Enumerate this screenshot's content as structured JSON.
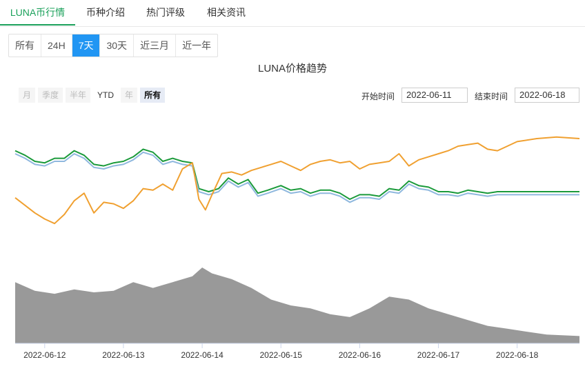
{
  "tabs": [
    "LUNA币行情",
    "币种介绍",
    "热门评级",
    "相关资讯"
  ],
  "ranges": [
    "所有",
    "24H",
    "7天",
    "30天",
    "近三月",
    "近一年"
  ],
  "range_selected": "7天",
  "zoom_buttons": [
    "月",
    "季度",
    "半年",
    "YTD",
    "年",
    "所有"
  ],
  "zoom_selected": "所有",
  "start_label": "开始时间",
  "start_date": "2022-06-11",
  "end_label": "结束时间",
  "end_date": "2022-06-18",
  "colors": {
    "accent": "#1aa05a",
    "range_active": "#2196f3",
    "green_line": "#1a9a3a",
    "blue_line": "#8fb8de",
    "orange_line": "#f0a030",
    "volume": "#999999"
  },
  "chart_data": {
    "type": "line",
    "title": "LUNA价格趋势",
    "x_ticks": [
      "2022-06-12",
      "2022-06-13",
      "2022-06-14",
      "2022-06-15",
      "2022-06-16",
      "2022-06-17",
      "2022-06-18"
    ],
    "x_range": [
      "2022-06-11T15:00",
      "2022-06-18T19:00"
    ],
    "y_ticks": [],
    "legend": "none",
    "grid": false,
    "series": [
      {
        "color": "green",
        "points": [
          [
            "06-11T15:00",
            0.87
          ],
          [
            "06-11T18:00",
            0.84
          ],
          [
            "06-11T21:00",
            0.8
          ],
          [
            "06-12T00:00",
            0.79
          ],
          [
            "06-12T03:00",
            0.82
          ],
          [
            "06-12T06:00",
            0.82
          ],
          [
            "06-12T09:00",
            0.87
          ],
          [
            "06-12T12:00",
            0.84
          ],
          [
            "06-12T15:00",
            0.78
          ],
          [
            "06-12T18:00",
            0.77
          ],
          [
            "06-12T21:00",
            0.79
          ],
          [
            "06-13T00:00",
            0.8
          ],
          [
            "06-13T03:00",
            0.83
          ],
          [
            "06-13T06:00",
            0.88
          ],
          [
            "06-13T09:00",
            0.86
          ],
          [
            "06-13T12:00",
            0.8
          ],
          [
            "06-13T15:00",
            0.82
          ],
          [
            "06-13T18:00",
            0.8
          ],
          [
            "06-13T21:00",
            0.79
          ],
          [
            "06-13T23:00",
            0.62
          ],
          [
            "06-14T02:00",
            0.6
          ],
          [
            "06-14T05:00",
            0.62
          ],
          [
            "06-14T08:00",
            0.69
          ],
          [
            "06-14T11:00",
            0.65
          ],
          [
            "06-14T14:00",
            0.68
          ],
          [
            "06-14T17:00",
            0.59
          ],
          [
            "06-14T20:00",
            0.61
          ],
          [
            "06-15T00:00",
            0.64
          ],
          [
            "06-15T03:00",
            0.61
          ],
          [
            "06-15T06:00",
            0.62
          ],
          [
            "06-15T09:00",
            0.59
          ],
          [
            "06-15T12:00",
            0.61
          ],
          [
            "06-15T15:00",
            0.61
          ],
          [
            "06-15T18:00",
            0.59
          ],
          [
            "06-15T21:00",
            0.55
          ],
          [
            "06-16T00:00",
            0.58
          ],
          [
            "06-16T03:00",
            0.58
          ],
          [
            "06-16T06:00",
            0.57
          ],
          [
            "06-16T09:00",
            0.62
          ],
          [
            "06-16T12:00",
            0.61
          ],
          [
            "06-16T15:00",
            0.67
          ],
          [
            "06-16T18:00",
            0.64
          ],
          [
            "06-16T21:00",
            0.63
          ],
          [
            "06-17T00:00",
            0.6
          ],
          [
            "06-17T03:00",
            0.6
          ],
          [
            "06-17T06:00",
            0.59
          ],
          [
            "06-17T09:00",
            0.61
          ],
          [
            "06-17T12:00",
            0.6
          ],
          [
            "06-17T15:00",
            0.59
          ],
          [
            "06-17T18:00",
            0.6
          ],
          [
            "06-18T00:00",
            0.6
          ],
          [
            "06-18T06:00",
            0.6
          ],
          [
            "06-18T12:00",
            0.6
          ],
          [
            "06-18T19:00",
            0.6
          ]
        ]
      },
      {
        "color": "blue",
        "points": [
          [
            "06-11T15:00",
            0.85
          ],
          [
            "06-11T18:00",
            0.82
          ],
          [
            "06-11T21:00",
            0.78
          ],
          [
            "06-12T00:00",
            0.77
          ],
          [
            "06-12T03:00",
            0.8
          ],
          [
            "06-12T06:00",
            0.8
          ],
          [
            "06-12T09:00",
            0.85
          ],
          [
            "06-12T12:00",
            0.82
          ],
          [
            "06-12T15:00",
            0.76
          ],
          [
            "06-12T18:00",
            0.75
          ],
          [
            "06-12T21:00",
            0.77
          ],
          [
            "06-13T00:00",
            0.78
          ],
          [
            "06-13T03:00",
            0.81
          ],
          [
            "06-13T06:00",
            0.86
          ],
          [
            "06-13T09:00",
            0.84
          ],
          [
            "06-13T12:00",
            0.78
          ],
          [
            "06-13T15:00",
            0.8
          ],
          [
            "06-13T18:00",
            0.78
          ],
          [
            "06-13T21:00",
            0.77
          ],
          [
            "06-13T23:00",
            0.6
          ],
          [
            "06-14T02:00",
            0.58
          ],
          [
            "06-14T05:00",
            0.6
          ],
          [
            "06-14T08:00",
            0.67
          ],
          [
            "06-14T11:00",
            0.63
          ],
          [
            "06-14T14:00",
            0.66
          ],
          [
            "06-14T17:00",
            0.57
          ],
          [
            "06-14T20:00",
            0.59
          ],
          [
            "06-15T00:00",
            0.62
          ],
          [
            "06-15T03:00",
            0.59
          ],
          [
            "06-15T06:00",
            0.6
          ],
          [
            "06-15T09:00",
            0.57
          ],
          [
            "06-15T12:00",
            0.59
          ],
          [
            "06-15T15:00",
            0.59
          ],
          [
            "06-15T18:00",
            0.57
          ],
          [
            "06-15T21:00",
            0.53
          ],
          [
            "06-16T00:00",
            0.56
          ],
          [
            "06-16T03:00",
            0.56
          ],
          [
            "06-16T06:00",
            0.55
          ],
          [
            "06-16T09:00",
            0.6
          ],
          [
            "06-16T12:00",
            0.59
          ],
          [
            "06-16T15:00",
            0.65
          ],
          [
            "06-16T18:00",
            0.62
          ],
          [
            "06-16T21:00",
            0.61
          ],
          [
            "06-17T00:00",
            0.58
          ],
          [
            "06-17T03:00",
            0.58
          ],
          [
            "06-17T06:00",
            0.57
          ],
          [
            "06-17T09:00",
            0.59
          ],
          [
            "06-17T12:00",
            0.58
          ],
          [
            "06-17T15:00",
            0.57
          ],
          [
            "06-17T18:00",
            0.58
          ],
          [
            "06-18T00:00",
            0.58
          ],
          [
            "06-18T06:00",
            0.58
          ],
          [
            "06-18T12:00",
            0.58
          ],
          [
            "06-18T19:00",
            0.58
          ]
        ]
      },
      {
        "color": "orange",
        "points": [
          [
            "06-11T15:00",
            0.56
          ],
          [
            "06-11T18:00",
            0.51
          ],
          [
            "06-11T21:00",
            0.46
          ],
          [
            "06-12T00:00",
            0.42
          ],
          [
            "06-12T03:00",
            0.39
          ],
          [
            "06-12T06:00",
            0.45
          ],
          [
            "06-12T09:00",
            0.54
          ],
          [
            "06-12T12:00",
            0.59
          ],
          [
            "06-12T15:00",
            0.46
          ],
          [
            "06-12T18:00",
            0.53
          ],
          [
            "06-12T21:00",
            0.52
          ],
          [
            "06-13T00:00",
            0.49
          ],
          [
            "06-13T03:00",
            0.54
          ],
          [
            "06-13T06:00",
            0.62
          ],
          [
            "06-13T09:00",
            0.61
          ],
          [
            "06-13T12:00",
            0.65
          ],
          [
            "06-13T15:00",
            0.61
          ],
          [
            "06-13T18:00",
            0.75
          ],
          [
            "06-13T21:00",
            0.79
          ],
          [
            "06-13T23:00",
            0.55
          ],
          [
            "06-14T01:00",
            0.48
          ],
          [
            "06-14T03:00",
            0.58
          ],
          [
            "06-14T06:00",
            0.72
          ],
          [
            "06-14T09:00",
            0.73
          ],
          [
            "06-14T12:00",
            0.71
          ],
          [
            "06-14T15:00",
            0.74
          ],
          [
            "06-14T18:00",
            0.76
          ],
          [
            "06-14T21:00",
            0.78
          ],
          [
            "06-15T00:00",
            0.8
          ],
          [
            "06-15T03:00",
            0.77
          ],
          [
            "06-15T06:00",
            0.74
          ],
          [
            "06-15T09:00",
            0.78
          ],
          [
            "06-15T12:00",
            0.8
          ],
          [
            "06-15T15:00",
            0.81
          ],
          [
            "06-15T18:00",
            0.79
          ],
          [
            "06-15T21:00",
            0.8
          ],
          [
            "06-16T00:00",
            0.75
          ],
          [
            "06-16T03:00",
            0.78
          ],
          [
            "06-16T06:00",
            0.79
          ],
          [
            "06-16T09:00",
            0.8
          ],
          [
            "06-16T12:00",
            0.85
          ],
          [
            "06-16T15:00",
            0.77
          ],
          [
            "06-16T18:00",
            0.81
          ],
          [
            "06-16T21:00",
            0.83
          ],
          [
            "06-17T00:00",
            0.85
          ],
          [
            "06-17T03:00",
            0.87
          ],
          [
            "06-17T06:00",
            0.9
          ],
          [
            "06-17T09:00",
            0.91
          ],
          [
            "06-17T12:00",
            0.92
          ],
          [
            "06-17T15:00",
            0.88
          ],
          [
            "06-17T18:00",
            0.87
          ],
          [
            "06-17T21:00",
            0.9
          ],
          [
            "06-18T00:00",
            0.93
          ],
          [
            "06-18T06:00",
            0.95
          ],
          [
            "06-18T12:00",
            0.96
          ],
          [
            "06-18T19:00",
            0.95
          ]
        ]
      },
      {
        "name": "volume",
        "type": "area",
        "points": [
          [
            "06-11T15:00",
            0.42
          ],
          [
            "06-11T21:00",
            0.36
          ],
          [
            "06-12T03:00",
            0.34
          ],
          [
            "06-12T09:00",
            0.37
          ],
          [
            "06-12T15:00",
            0.35
          ],
          [
            "06-12T21:00",
            0.36
          ],
          [
            "06-13T03:00",
            0.42
          ],
          [
            "06-13T09:00",
            0.38
          ],
          [
            "06-13T15:00",
            0.42
          ],
          [
            "06-13T21:00",
            0.46
          ],
          [
            "06-14T00:00",
            0.52
          ],
          [
            "06-14T03:00",
            0.48
          ],
          [
            "06-14T09:00",
            0.44
          ],
          [
            "06-14T15:00",
            0.38
          ],
          [
            "06-14T21:00",
            0.3
          ],
          [
            "06-15T03:00",
            0.26
          ],
          [
            "06-15T09:00",
            0.24
          ],
          [
            "06-15T15:00",
            0.2
          ],
          [
            "06-15T21:00",
            0.18
          ],
          [
            "06-16T03:00",
            0.24
          ],
          [
            "06-16T09:00",
            0.32
          ],
          [
            "06-16T15:00",
            0.3
          ],
          [
            "06-16T21:00",
            0.24
          ],
          [
            "06-17T03:00",
            0.2
          ],
          [
            "06-17T09:00",
            0.16
          ],
          [
            "06-17T15:00",
            0.12
          ],
          [
            "06-17T21:00",
            0.1
          ],
          [
            "06-18T03:00",
            0.08
          ],
          [
            "06-18T09:00",
            0.06
          ],
          [
            "06-18T19:00",
            0.05
          ]
        ]
      }
    ]
  }
}
